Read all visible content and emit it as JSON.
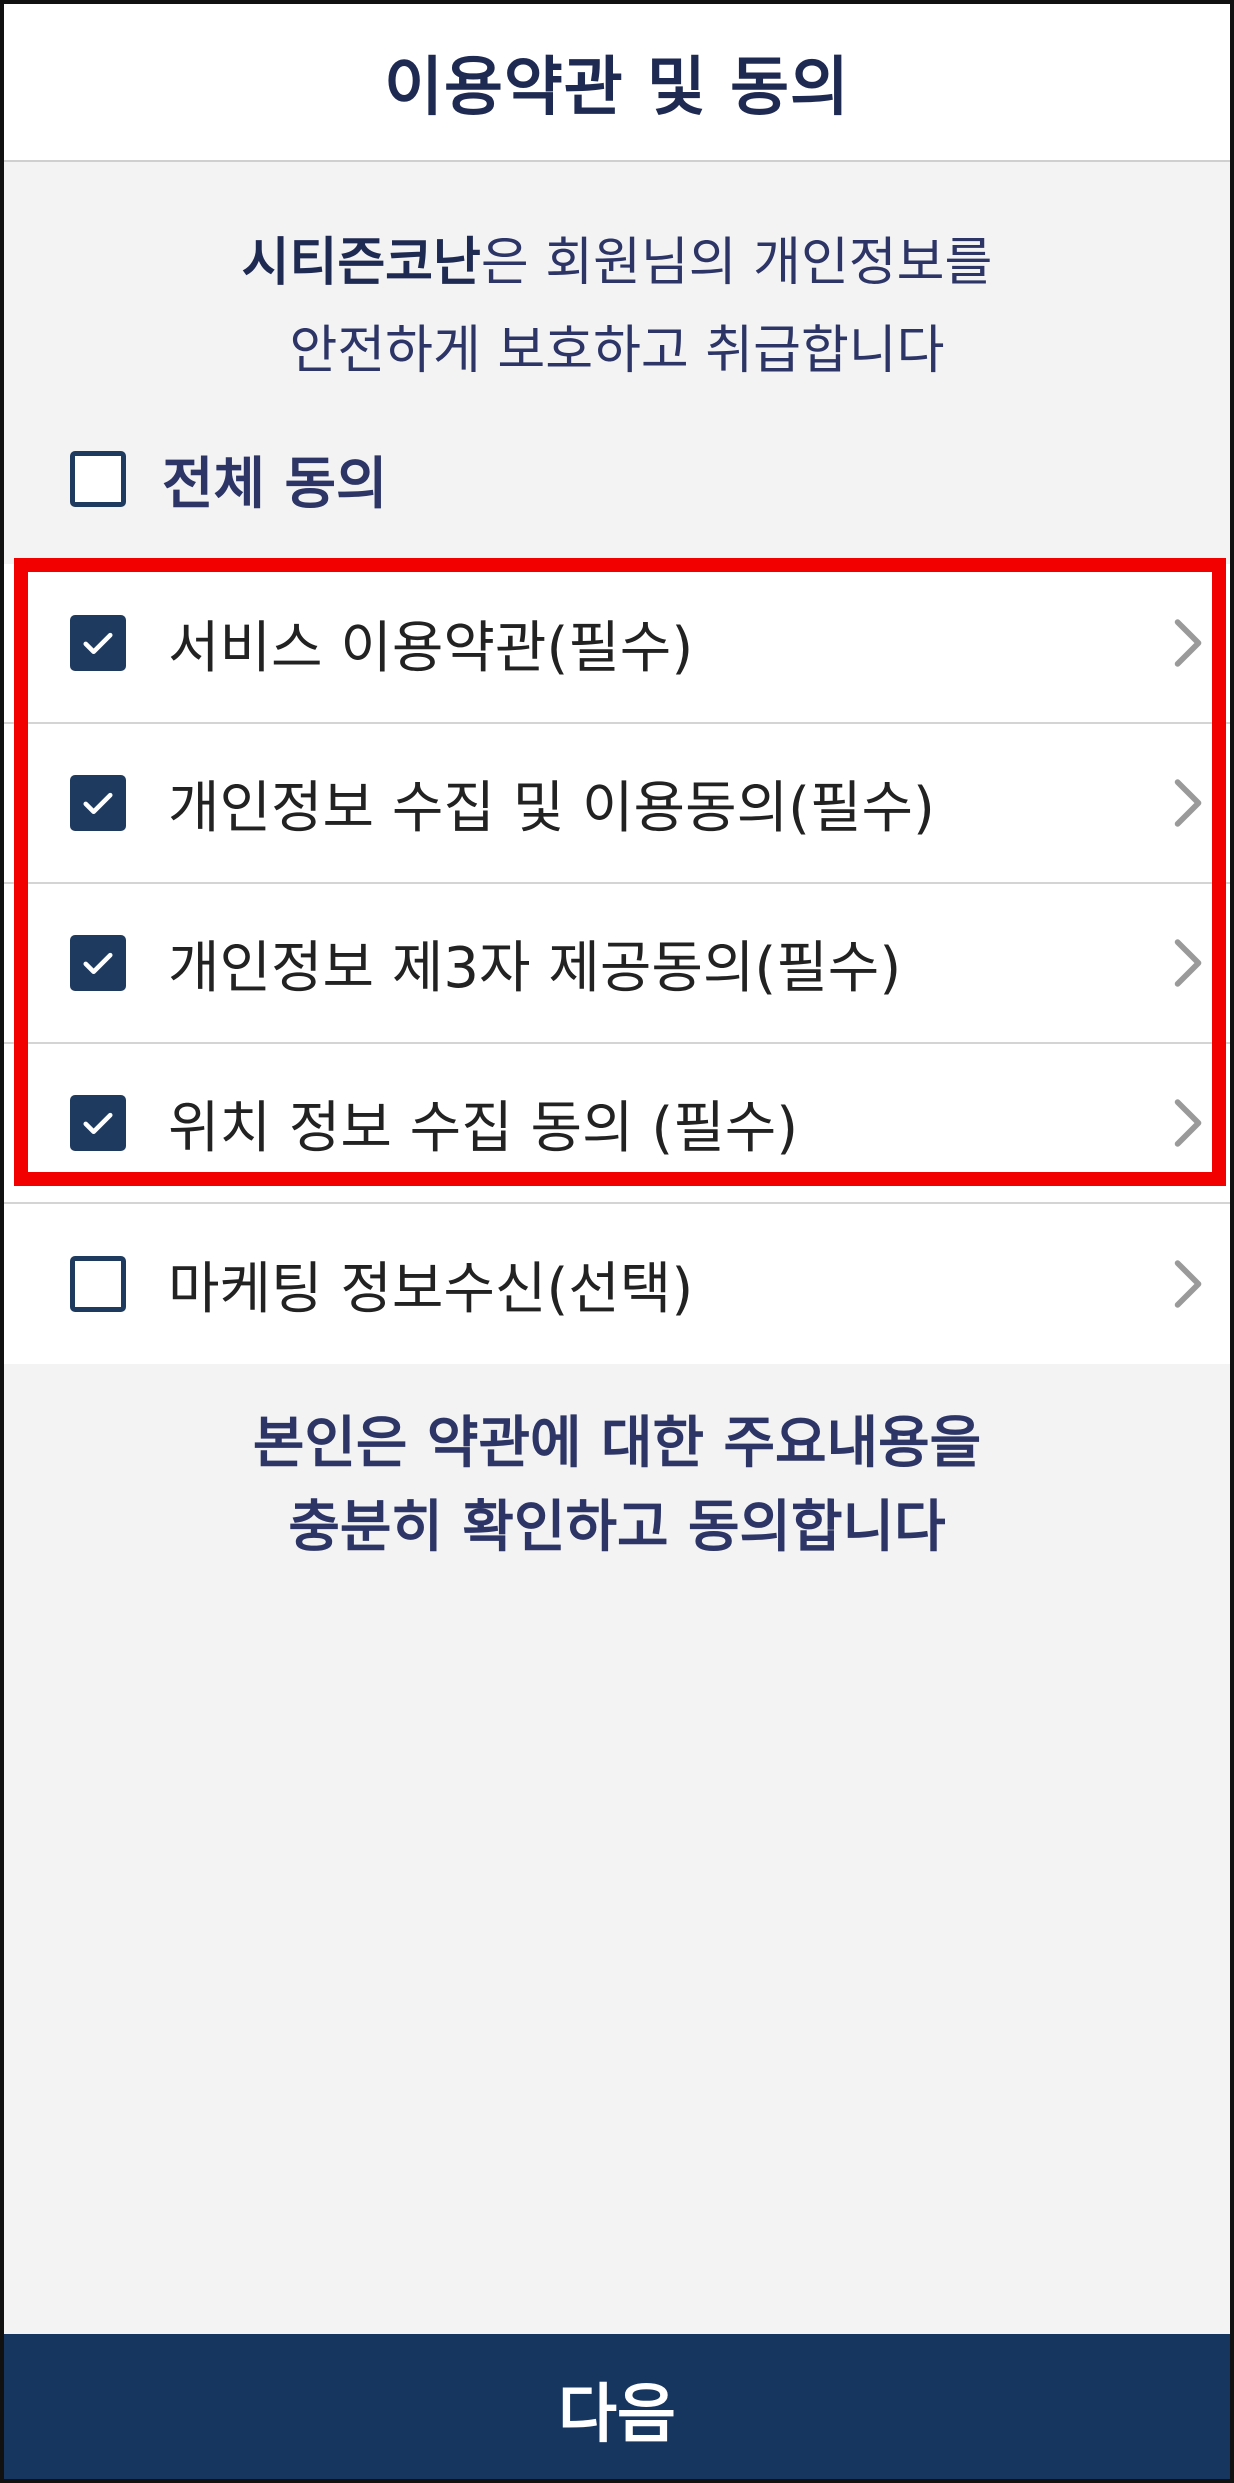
{
  "header": {
    "title": "이용약관 및 동의"
  },
  "intro": {
    "brand": "시티즌코난",
    "line1_rest": "은 회원님의 개인정보를",
    "line2": "안전하게 보호하고 취급합니다"
  },
  "check_all": {
    "label": "전체 동의",
    "checked": false
  },
  "agreements": [
    {
      "label": "서비스 이용약관(필수)",
      "checked": true
    },
    {
      "label": "개인정보 수집 및 이용동의(필수)",
      "checked": true
    },
    {
      "label": "개인정보 제3자 제공동의(필수)",
      "checked": true
    },
    {
      "label": "위치 정보 수집 동의 (필수)",
      "checked": true
    },
    {
      "label": "마케팅 정보수신(선택)",
      "checked": false
    }
  ],
  "confirm": {
    "line1": "본인은 약관에 대한 주요내용을",
    "line2": "충분히 확인하고 동의합니다"
  },
  "next_button": {
    "label": "다음"
  },
  "icons": {
    "checkbox": "checkbox-icon",
    "chevron": "chevron-right-icon"
  },
  "colors": {
    "navy": "#1e3a5f",
    "button": "#163660",
    "highlight": "#f20000",
    "text_primary": "#2c3566",
    "background": "#f3f3f3"
  }
}
